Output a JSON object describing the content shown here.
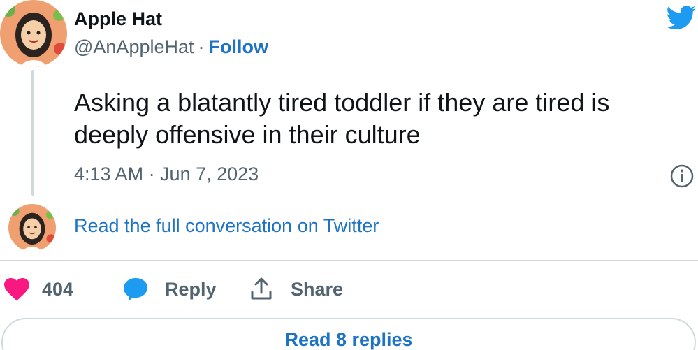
{
  "author": {
    "display_name": "Apple Hat",
    "handle": "@AnAppleHat",
    "separator": "·",
    "follow_label": "Follow"
  },
  "tweet": {
    "text": "Asking a blatantly tired toddler if they are tired is deeply offensive in their culture",
    "timestamp": "4:13 AM · Jun 7, 2023"
  },
  "conversation": {
    "read_full_label": "Read the full conversation on Twitter"
  },
  "actions": {
    "like_count": "404",
    "reply_label": "Reply",
    "share_label": "Share"
  },
  "replies": {
    "read_replies_label": "Read 8 replies"
  },
  "colors": {
    "link_blue": "#1d73c4",
    "twitter_blue": "#1d9bf0",
    "like_pink": "#f91880",
    "muted_gray": "#536471",
    "divider": "#cfd9de"
  },
  "icons": {
    "brand": "twitter-bird-icon",
    "info": "info-icon",
    "like": "heart-icon",
    "reply": "speech-bubble-icon",
    "share": "share-upload-icon"
  }
}
